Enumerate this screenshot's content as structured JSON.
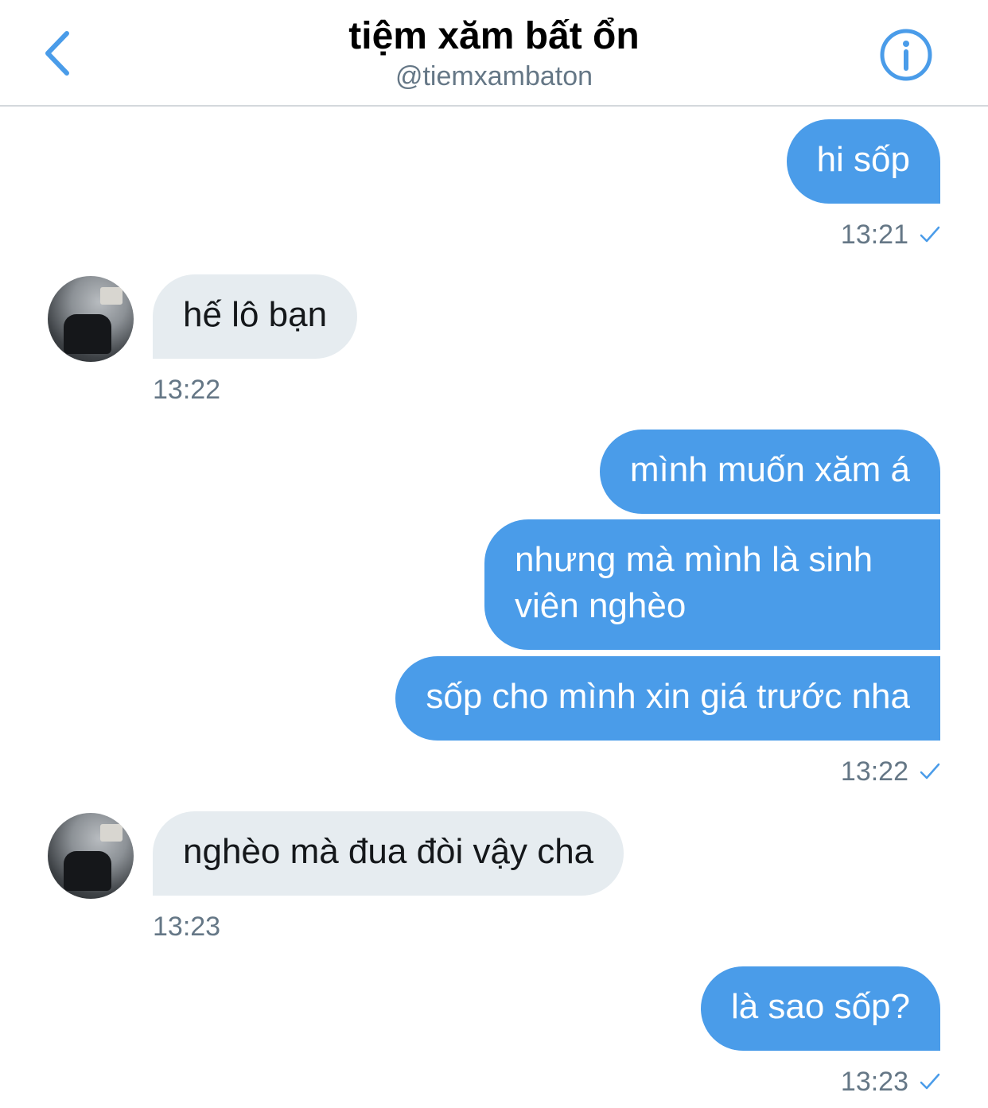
{
  "header": {
    "title": "tiệm xăm bất ổn",
    "handle": "@tiemxambaton",
    "back_icon": "chevron-left-icon",
    "info_icon": "info-circle-icon"
  },
  "colors": {
    "accent": "#4a9ce9",
    "received_bubble": "#e6ecf0",
    "secondary_text": "#657786"
  },
  "messages": [
    {
      "from": "me",
      "text": "hi sốp"
    },
    {
      "from": "me",
      "time": "13:21",
      "read": true
    },
    {
      "from": "them",
      "text": "hế lô bạn",
      "time": "13:22"
    },
    {
      "from": "me",
      "text": "mình muốn xăm á"
    },
    {
      "from": "me",
      "text": "nhưng mà mình là sinh viên nghèo"
    },
    {
      "from": "me",
      "text": "sốp cho mình xin giá trước nha",
      "time": "13:22",
      "read": true
    },
    {
      "from": "them",
      "text": "nghèo mà đua đòi vậy cha",
      "time": "13:23"
    },
    {
      "from": "me",
      "text": "là sao sốp?",
      "time": "13:23",
      "read": true
    }
  ]
}
